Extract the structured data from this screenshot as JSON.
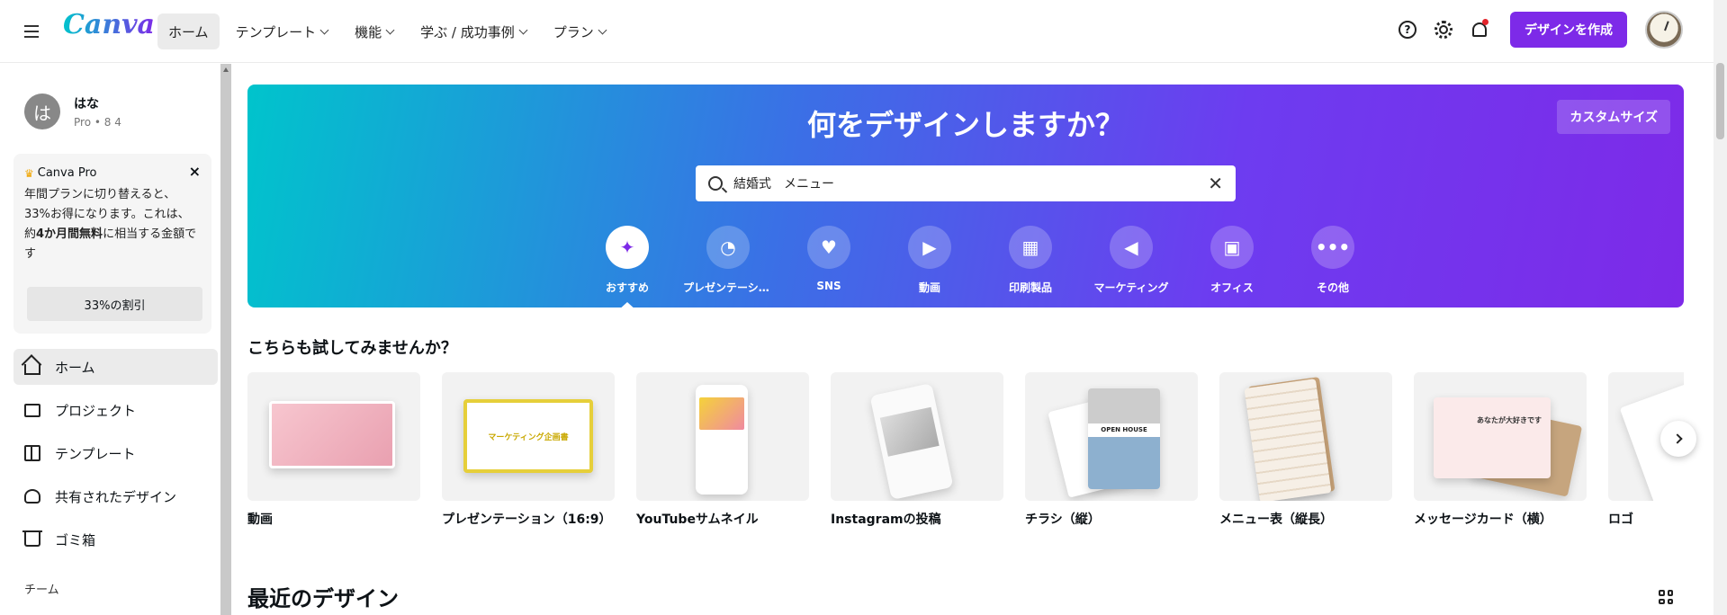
{
  "topbar": {
    "logo": "Canva",
    "nav": [
      {
        "label": "ホーム",
        "dropdown": false
      },
      {
        "label": "テンプレート",
        "dropdown": true
      },
      {
        "label": "機能",
        "dropdown": true
      },
      {
        "label": "学ぶ / 成功事例",
        "dropdown": true
      },
      {
        "label": "プラン",
        "dropdown": true
      }
    ],
    "help_icon": "?",
    "create_button": "デザインを作成"
  },
  "sidebar": {
    "user": {
      "avatar_letter": "は",
      "name": "はな",
      "meta": "Pro • 8 4"
    },
    "promo": {
      "title": "Canva Pro",
      "close": "×",
      "text_1": "年間プランに切り替えると、33%お得になります。これは、約",
      "text_bold": "4か月間無料",
      "text_2": "に相当する金額です",
      "button": "33%の割引"
    },
    "items": [
      {
        "label": "ホーム",
        "icon": "home-icon"
      },
      {
        "label": "プロジェクト",
        "icon": "folder-icon"
      },
      {
        "label": "テンプレート",
        "icon": "template-icon"
      },
      {
        "label": "共有されたデザイン",
        "icon": "shared-icon"
      },
      {
        "label": "ゴミ箱",
        "icon": "trash-icon"
      }
    ],
    "team_label": "チーム"
  },
  "hero": {
    "title": "何をデザインしますか？",
    "custom_size": "カスタムサイズ",
    "search_value": "結婚式　メニュー",
    "search_clear": "✕",
    "categories": [
      {
        "label": "おすすめ",
        "icon": "sparkle-icon",
        "glyph": "✦"
      },
      {
        "label": "プレゼンテーション",
        "icon": "presentation-icon",
        "glyph": "◔"
      },
      {
        "label": "SNS",
        "icon": "heart-icon",
        "glyph": "♥"
      },
      {
        "label": "動画",
        "icon": "video-icon",
        "glyph": "▶"
      },
      {
        "label": "印刷製品",
        "icon": "printer-icon",
        "glyph": "▦"
      },
      {
        "label": "マーケティング",
        "icon": "megaphone-icon",
        "glyph": "◀"
      },
      {
        "label": "オフィス",
        "icon": "briefcase-icon",
        "glyph": "▣"
      },
      {
        "label": "その他",
        "icon": "more-icon",
        "glyph": "•••"
      }
    ]
  },
  "suggestions": {
    "title": "こちらも試してみませんか？",
    "cards": [
      {
        "label": "動画"
      },
      {
        "label": "プレゼンテーション（16:9）",
        "thumb_title": "マーケティング企画書"
      },
      {
        "label": "YouTubeサムネイル"
      },
      {
        "label": "Instagramの投稿"
      },
      {
        "label": "チラシ（縦）",
        "thumb_title": "OPEN HOUSE"
      },
      {
        "label": "メニュー表（縦長）"
      },
      {
        "label": "メッセージカード（横）",
        "thumb_title": "あなたが大好きです"
      },
      {
        "label": "ロゴ"
      }
    ],
    "next": "›"
  },
  "recent": {
    "title": "最近のデザイン"
  },
  "colors": {
    "accent": "#7d2ae8",
    "teal": "#00c4cc"
  }
}
